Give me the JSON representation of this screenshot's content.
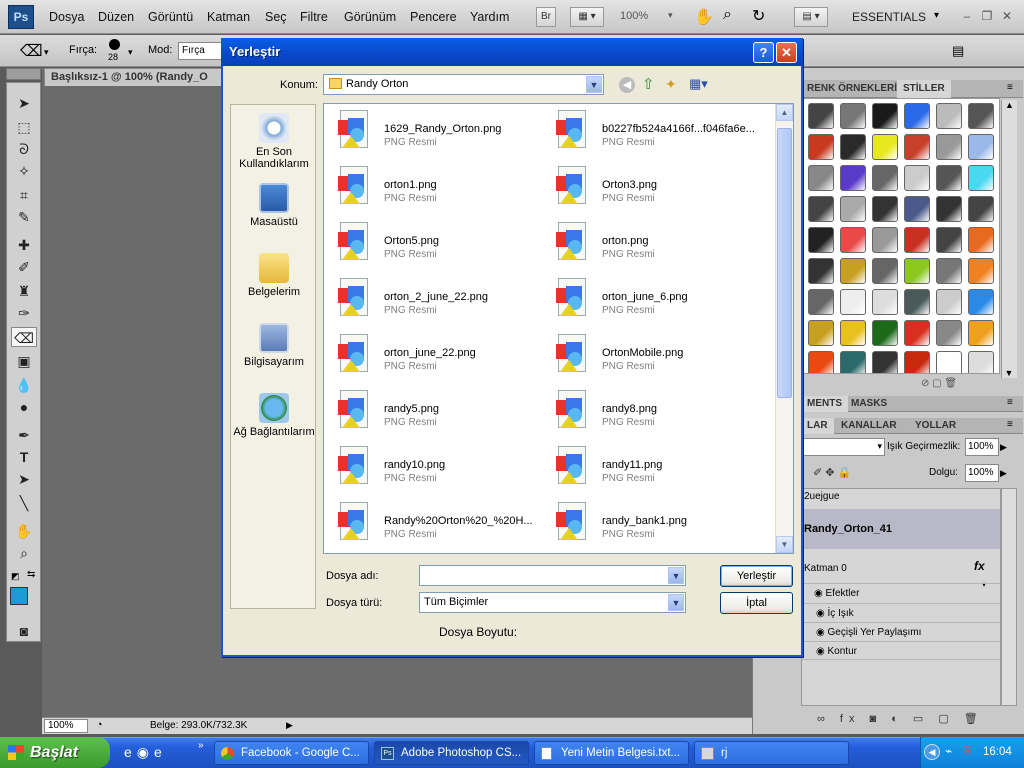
{
  "menubar": {
    "logo": "Ps",
    "items": [
      "Dosya",
      "Düzen",
      "Görüntü",
      "Katman",
      "Seç",
      "Filtre",
      "Görünüm",
      "Pencere",
      "Yardım"
    ],
    "bridge": "Br",
    "zoom": "100%",
    "workspace": "ESSENTIALS"
  },
  "options": {
    "brush_label": "Fırça:",
    "brush_size": "28",
    "mode_label": "Mod:",
    "mode_value": "Fırça"
  },
  "document": {
    "tab_title": "Başlıksız-1 @ 100% (Randy_O",
    "zoom": "100%",
    "status": "Belge: 293.0K/732.3K"
  },
  "panels": {
    "swatch_tabs": [
      "RENK ÖRNEKLERİ",
      "STİLLER"
    ],
    "adj_tabs": [
      "MENTS",
      "MASKS"
    ],
    "layer_tabs": [
      "LAR",
      "KANALLAR",
      "YOLLAR"
    ],
    "opacity_label": "Işık Geçirmezlik:",
    "opacity_value": "100%",
    "fill_label": "Dolgu:",
    "fill_value": "100%",
    "layers": [
      "2uejgue",
      "Randy_Orton_41",
      "Katman 0"
    ],
    "effects_label": "Efektler",
    "effects": [
      "İç Işık",
      "Geçişli Yer Paylaşımı",
      "Kontur"
    ],
    "fx": "fx"
  },
  "dialog": {
    "title": "Yerleştir",
    "help": "?",
    "close": "✕",
    "location_label": "Konum:",
    "location_value": "Randy Orton",
    "places": [
      "En Son Kullandıklarım",
      "Masaüstü",
      "Belgelerim",
      "Bilgisayarım",
      "Ağ Bağlantılarım"
    ],
    "files": [
      {
        "name": "1629_Randy_Orton.png",
        "type": "PNG Resmi"
      },
      {
        "name": "b0227fb524a4166f...f046fa6e...",
        "type": "PNG Resmi"
      },
      {
        "name": "orton1.png",
        "type": "PNG Resmi"
      },
      {
        "name": "Orton3.png",
        "type": "PNG Resmi"
      },
      {
        "name": "Orton5.png",
        "type": "PNG Resmi"
      },
      {
        "name": "orton.png",
        "type": "PNG Resmi"
      },
      {
        "name": "orton_2_june_22.png",
        "type": "PNG Resmi"
      },
      {
        "name": "orton_june_6.png",
        "type": "PNG Resmi"
      },
      {
        "name": "orton_june_22.png",
        "type": "PNG Resmi"
      },
      {
        "name": "OrtonMobile.png",
        "type": "PNG Resmi"
      },
      {
        "name": "randy5.png",
        "type": "PNG Resmi"
      },
      {
        "name": "randy8.png",
        "type": "PNG Resmi"
      },
      {
        "name": "randy10.png",
        "type": "PNG Resmi"
      },
      {
        "name": "randy11.png",
        "type": "PNG Resmi"
      },
      {
        "name": "Randy%20Orton%20_%20H...",
        "type": "PNG Resmi"
      },
      {
        "name": "randy_bank1.png",
        "type": "PNG Resmi"
      }
    ],
    "filename_label": "Dosya adı:",
    "filename_value": "",
    "filetype_label": "Dosya türü:",
    "filetype_value": "Tüm Biçimler",
    "place_button": "Yerleştir",
    "cancel_button": "İptal",
    "filesize_label": "Dosya Boyutu:"
  },
  "taskbar": {
    "start": "Başlat",
    "items": [
      "Facebook - Google C...",
      "Adobe Photoshop CS...",
      "Yeni Metin Belgesi.txt...",
      "rj"
    ],
    "clock": "16:04"
  },
  "colors": {
    "titlebar": "#0a5fe6",
    "taskbar": "#245edb",
    "start": "#3a9a2c",
    "foreground_swatch": "#1a9ad6"
  }
}
